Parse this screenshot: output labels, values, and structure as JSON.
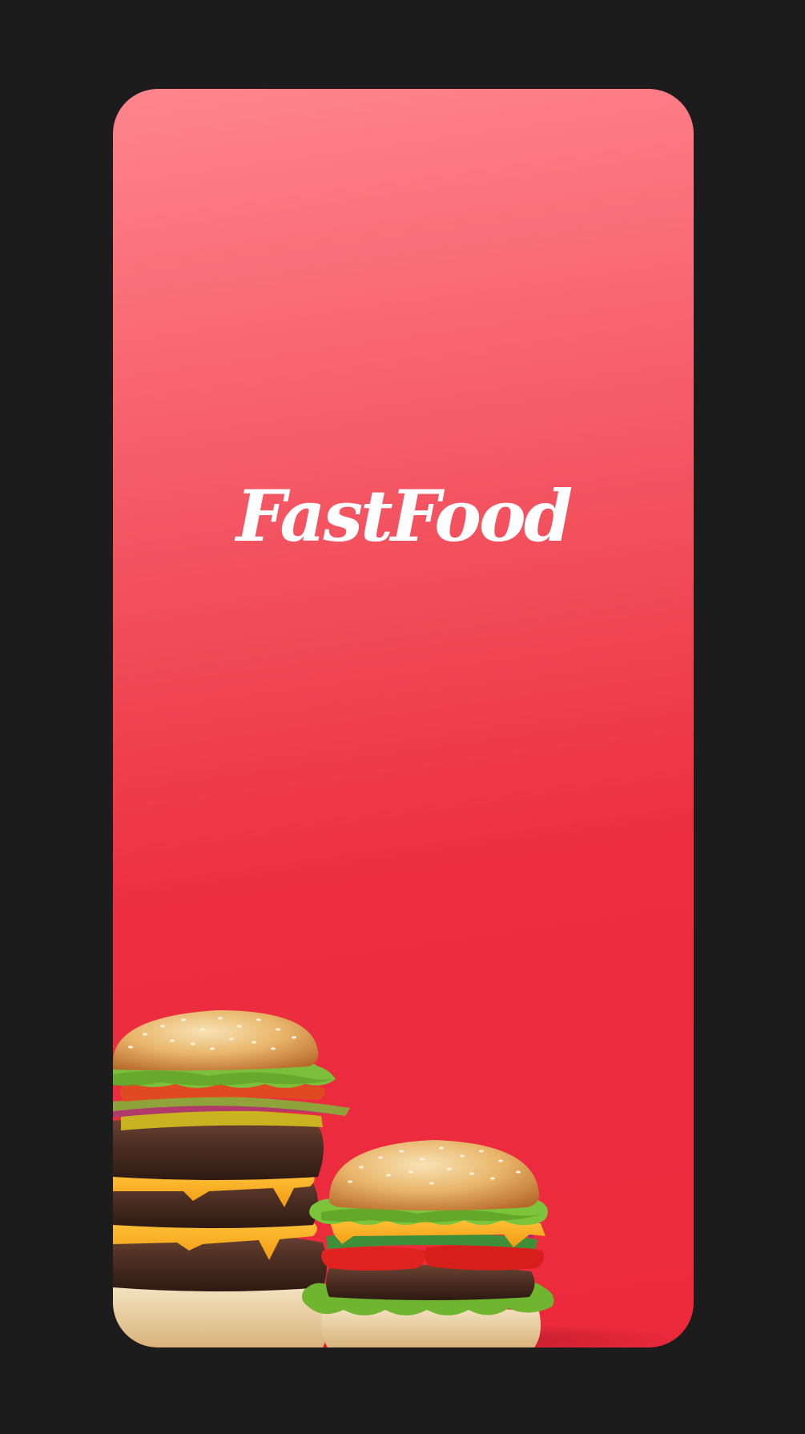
{
  "splash": {
    "title": "FastFood",
    "background_gradient": [
      "#ff858c",
      "#f14a58",
      "#ec2a3c"
    ],
    "hero_image": "burgers-image"
  }
}
